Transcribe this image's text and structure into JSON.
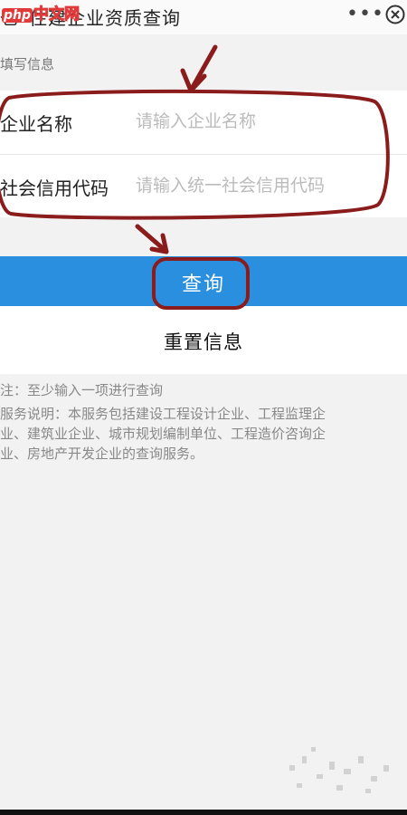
{
  "header": {
    "edge_glyph": "乜",
    "title": "住建企业资质查询",
    "watermark_php": "php",
    "watermark_text": "中文网",
    "more_icon": "more-horizontal-icon",
    "close_icon": "close-circle-icon"
  },
  "section_label": "填写信息",
  "form": {
    "company_name_label": "企业名称",
    "company_name_placeholder": "请输入企业名称",
    "credit_code_label": "社会信用代码",
    "credit_code_placeholder": "请输入统一社会信用代码"
  },
  "actions": {
    "query_label": "查询",
    "reset_label": "重置信息"
  },
  "notes": {
    "note": "注：至少输入一项进行查询",
    "description": "服务说明：本服务包括建设工程设计企业、工程监理企\n业、建筑业企业、城市规划编制单位、工程造价咨询企\n业、房地产开发企业的查询服务。"
  },
  "colors": {
    "primary": "#2b8fe0",
    "annotation": "#8b1c1c",
    "background": "#f2f2f2"
  }
}
